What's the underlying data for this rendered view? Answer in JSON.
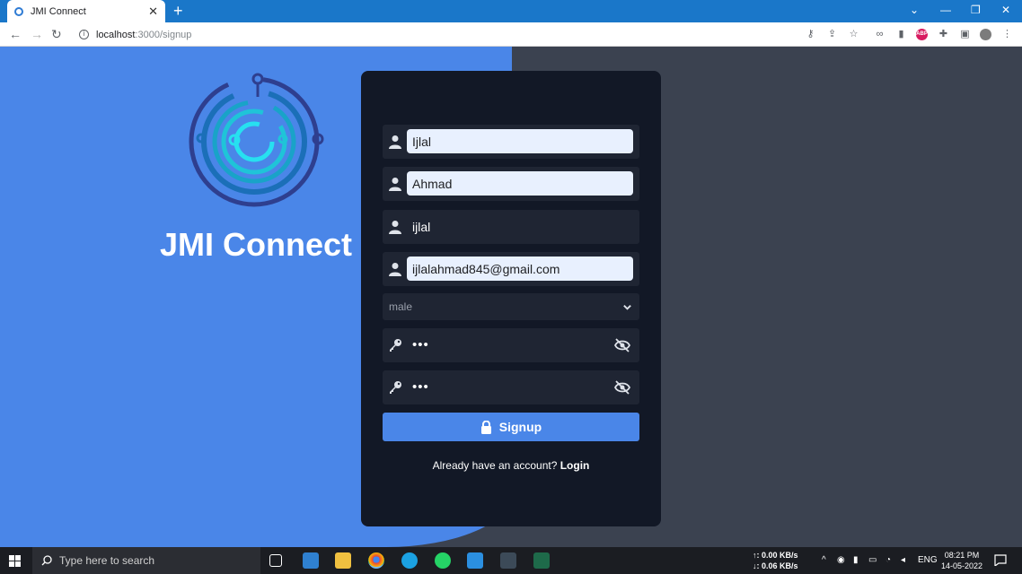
{
  "browser": {
    "tab_title": "JMI Connect",
    "tab_close": "✕",
    "new_tab": "+",
    "url_host": "localhost",
    "url_path": ":3000/signup",
    "win_min": "—",
    "win_max": "❐",
    "win_close": "✕",
    "tab_search": "⌄"
  },
  "brand": {
    "name": "JMI Connect"
  },
  "form": {
    "first_name": "Ijlal",
    "last_name": "Ahmad",
    "username": "ijlal",
    "email": "ijlalahmad845@gmail.com",
    "gender": "male",
    "password": "•••",
    "confirm_password": "•••",
    "signup_label": "Signup",
    "already_text": "Already have an account? ",
    "login_label": "Login"
  },
  "taskbar": {
    "search_placeholder": "Type here to search",
    "net_up": "↑: 0.00 KB/s",
    "net_down": "↓: 0.06 KB/s",
    "lang": "ENG",
    "time": "08:21 PM",
    "date": "14-05-2022"
  },
  "colors": {
    "accent": "#4a86e8",
    "card": "#121826",
    "page_bg": "#3b4250",
    "tabbar": "#1a77c9"
  }
}
